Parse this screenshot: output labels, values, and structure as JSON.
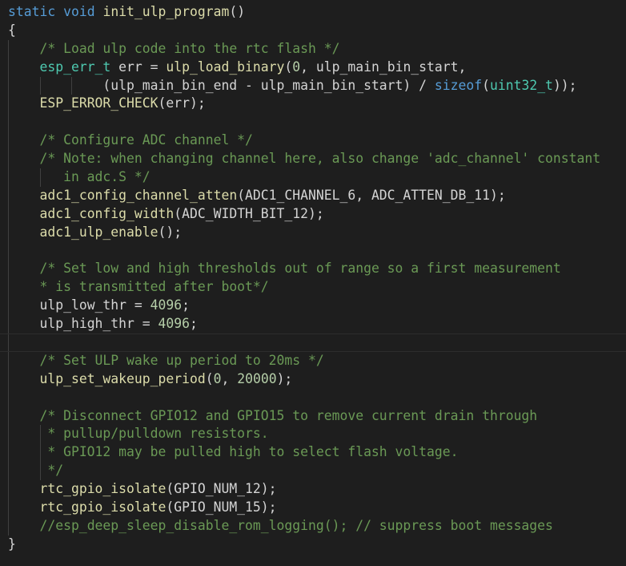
{
  "editor": {
    "language": "c",
    "colors": {
      "background": "#1e1e1e",
      "keyword": "#569cd6",
      "function": "#dcdcaa",
      "type": "#4ec9b0",
      "number": "#b5cea8",
      "comment": "#6a9955",
      "text": "#d4d4d4"
    },
    "lines": [
      {
        "indent": 0,
        "guides": [],
        "tokens": [
          {
            "t": "kw",
            "v": "static"
          },
          {
            "t": "pl",
            "v": " "
          },
          {
            "t": "kw",
            "v": "void"
          },
          {
            "t": "pl",
            "v": " "
          },
          {
            "t": "fn",
            "v": "init_ulp_program"
          },
          {
            "t": "pl",
            "v": "()"
          }
        ]
      },
      {
        "indent": 0,
        "guides": [],
        "tokens": [
          {
            "t": "pl",
            "v": "{"
          }
        ]
      },
      {
        "indent": 4,
        "guides": [
          0
        ],
        "tokens": [
          {
            "t": "cm",
            "v": "/* Load ulp code into the rtc flash */"
          }
        ]
      },
      {
        "indent": 4,
        "guides": [
          0
        ],
        "tokens": [
          {
            "t": "ty",
            "v": "esp_err_t"
          },
          {
            "t": "pl",
            "v": " err = "
          },
          {
            "t": "fn",
            "v": "ulp_load_binary"
          },
          {
            "t": "pl",
            "v": "("
          },
          {
            "t": "num",
            "v": "0"
          },
          {
            "t": "pl",
            "v": ", ulp_main_bin_start,"
          }
        ]
      },
      {
        "indent": 12,
        "guides": [
          0,
          4,
          8
        ],
        "tokens": [
          {
            "t": "pl",
            "v": "(ulp_main_bin_end - ulp_main_bin_start) / "
          },
          {
            "t": "kw",
            "v": "sizeof"
          },
          {
            "t": "pl",
            "v": "("
          },
          {
            "t": "ty",
            "v": "uint32_t"
          },
          {
            "t": "pl",
            "v": "));"
          }
        ]
      },
      {
        "indent": 4,
        "guides": [
          0
        ],
        "tokens": [
          {
            "t": "mac",
            "v": "ESP_ERROR_CHECK"
          },
          {
            "t": "pl",
            "v": "(err);"
          }
        ]
      },
      {
        "indent": 0,
        "guides": [
          0
        ],
        "tokens": []
      },
      {
        "indent": 4,
        "guides": [
          0
        ],
        "tokens": [
          {
            "t": "cm",
            "v": "/* Configure ADC channel */"
          }
        ]
      },
      {
        "indent": 4,
        "guides": [
          0
        ],
        "tokens": [
          {
            "t": "cm",
            "v": "/* Note: when changing channel here, also change 'adc_channel' constant"
          }
        ]
      },
      {
        "indent": 7,
        "guides": [
          0,
          4
        ],
        "tokens": [
          {
            "t": "cm",
            "v": "in adc.S */"
          }
        ]
      },
      {
        "indent": 4,
        "guides": [
          0
        ],
        "tokens": [
          {
            "t": "fn",
            "v": "adc1_config_channel_atten"
          },
          {
            "t": "pl",
            "v": "(ADC1_CHANNEL_6, ADC_ATTEN_DB_11);"
          }
        ]
      },
      {
        "indent": 4,
        "guides": [
          0
        ],
        "tokens": [
          {
            "t": "fn",
            "v": "adc1_config_width"
          },
          {
            "t": "pl",
            "v": "(ADC_WIDTH_BIT_12);"
          }
        ]
      },
      {
        "indent": 4,
        "guides": [
          0
        ],
        "tokens": [
          {
            "t": "fn",
            "v": "adc1_ulp_enable"
          },
          {
            "t": "pl",
            "v": "();"
          }
        ]
      },
      {
        "indent": 0,
        "guides": [
          0
        ],
        "tokens": []
      },
      {
        "indent": 4,
        "guides": [
          0
        ],
        "tokens": [
          {
            "t": "cm",
            "v": "/* Set low and high thresholds out of range so a first measurement"
          }
        ]
      },
      {
        "indent": 4,
        "guides": [
          0
        ],
        "tokens": [
          {
            "t": "cm",
            "v": "* is transmitted after boot*/"
          }
        ]
      },
      {
        "indent": 4,
        "guides": [
          0
        ],
        "tokens": [
          {
            "t": "pl",
            "v": "ulp_low_thr = "
          },
          {
            "t": "num",
            "v": "4096"
          },
          {
            "t": "pl",
            "v": ";"
          }
        ]
      },
      {
        "indent": 4,
        "guides": [
          0
        ],
        "tokens": [
          {
            "t": "pl",
            "v": "ulp_high_thr = "
          },
          {
            "t": "num",
            "v": "4096"
          },
          {
            "t": "pl",
            "v": ";"
          }
        ]
      },
      {
        "indent": 0,
        "guides": [
          0
        ],
        "tokens": [],
        "current": true
      },
      {
        "indent": 4,
        "guides": [
          0
        ],
        "tokens": [
          {
            "t": "cm",
            "v": "/* Set ULP wake up period to 20ms */"
          }
        ]
      },
      {
        "indent": 4,
        "guides": [
          0
        ],
        "tokens": [
          {
            "t": "fn",
            "v": "ulp_set_wakeup_period"
          },
          {
            "t": "pl",
            "v": "("
          },
          {
            "t": "num",
            "v": "0"
          },
          {
            "t": "pl",
            "v": ", "
          },
          {
            "t": "num",
            "v": "20000"
          },
          {
            "t": "pl",
            "v": ");"
          }
        ]
      },
      {
        "indent": 0,
        "guides": [
          0
        ],
        "tokens": []
      },
      {
        "indent": 4,
        "guides": [
          0
        ],
        "tokens": [
          {
            "t": "cm",
            "v": "/* Disconnect GPIO12 and GPIO15 to remove current drain through"
          }
        ]
      },
      {
        "indent": 5,
        "guides": [
          0,
          4
        ],
        "tokens": [
          {
            "t": "cm",
            "v": "* pullup/pulldown resistors."
          }
        ]
      },
      {
        "indent": 5,
        "guides": [
          0,
          4
        ],
        "tokens": [
          {
            "t": "cm",
            "v": "* GPIO12 may be pulled high to select flash voltage."
          }
        ]
      },
      {
        "indent": 5,
        "guides": [
          0,
          4
        ],
        "tokens": [
          {
            "t": "cm",
            "v": "*/"
          }
        ]
      },
      {
        "indent": 4,
        "guides": [
          0
        ],
        "tokens": [
          {
            "t": "fn",
            "v": "rtc_gpio_isolate"
          },
          {
            "t": "pl",
            "v": "(GPIO_NUM_12);"
          }
        ]
      },
      {
        "indent": 4,
        "guides": [
          0
        ],
        "tokens": [
          {
            "t": "fn",
            "v": "rtc_gpio_isolate"
          },
          {
            "t": "pl",
            "v": "(GPIO_NUM_15);"
          }
        ]
      },
      {
        "indent": 4,
        "guides": [
          0
        ],
        "tokens": [
          {
            "t": "cm",
            "v": "//esp_deep_sleep_disable_rom_logging(); // suppress boot messages"
          }
        ]
      },
      {
        "indent": 0,
        "guides": [],
        "tokens": [
          {
            "t": "pl",
            "v": "}"
          }
        ]
      }
    ]
  }
}
